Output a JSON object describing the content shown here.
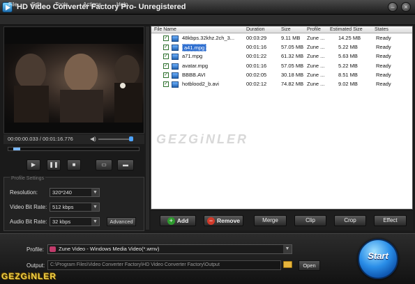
{
  "window": {
    "title": "HD Video Converter Factory Pro- Unregistered"
  },
  "menu": [
    "File",
    "Edit",
    "Tools",
    "Actions",
    "Help"
  ],
  "player": {
    "time": "00:00:00.033 / 00:01:16.776",
    "seek_fraction": 0.04,
    "volume_fraction": 0.88
  },
  "profile_settings": {
    "legend": "Profile Settings",
    "resolution": {
      "label": "Resolution:",
      "value": "320*240"
    },
    "video_bitrate": {
      "label": "Video Bit Rate:",
      "value": "512 kbps"
    },
    "audio_bitrate": {
      "label": "Audio Bit Rate:",
      "value": "32 kbps"
    },
    "advanced_label": "Advanced"
  },
  "file_list": {
    "columns": [
      "File Name",
      "Duration",
      "Size",
      "Profile",
      "Estimated Size",
      "States"
    ],
    "rows": [
      {
        "name": "48kbps.32khz.2ch_3...",
        "duration": "00:03:29",
        "size": "9.11 MB",
        "profile": "Zune ...",
        "est": "14.25 MB",
        "state": "Ready",
        "selected": false
      },
      {
        "name": "a41.mpg",
        "duration": "00:01:16",
        "size": "57.05 MB",
        "profile": "Zune ...",
        "est": "5.22 MB",
        "state": "Ready",
        "selected": true
      },
      {
        "name": "a71.mpg",
        "duration": "00:01:22",
        "size": "61.32 MB",
        "profile": "Zune ...",
        "est": "5.63 MB",
        "state": "Ready",
        "selected": false
      },
      {
        "name": "avatar.mpg",
        "duration": "00:01:16",
        "size": "57.05 MB",
        "profile": "Zune ...",
        "est": "5.22 MB",
        "state": "Ready",
        "selected": false
      },
      {
        "name": "BBBB.AVI",
        "duration": "00:02:05",
        "size": "30.18 MB",
        "profile": "Zune ...",
        "est": "8.51 MB",
        "state": "Ready",
        "selected": false
      },
      {
        "name": "hotblood2_b.avi",
        "duration": "00:02:12",
        "size": "74.82 MB",
        "profile": "Zune ...",
        "est": "9.02 MB",
        "state": "Ready",
        "selected": false
      }
    ]
  },
  "watermark": "GEZGiNLER",
  "actions": {
    "add": "Add",
    "remove": "Remove",
    "merge": "Merge",
    "clip": "Clip",
    "crop": "Crop",
    "effect": "Effect"
  },
  "output": {
    "profile_label": "Profile:",
    "profile_value": "Zune Video - Windows Media Video(*.wmv)",
    "output_label": "Output:",
    "output_path": "C:\\Program Files\\Video Converter Factory\\HD Video Converter Factory\\Output",
    "open_label": "Open",
    "start_label": "Start"
  },
  "brand": "GEZGiNLER"
}
